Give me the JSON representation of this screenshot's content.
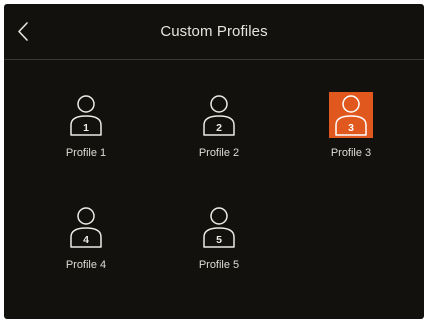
{
  "header": {
    "title": "Custom Profiles",
    "back_icon": "chevron-left-icon"
  },
  "accent_color": "#e1581e",
  "profiles": [
    {
      "number": "1",
      "label": "Profile 1",
      "selected": false,
      "icon": "user-icon"
    },
    {
      "number": "2",
      "label": "Profile 2",
      "selected": false,
      "icon": "user-icon"
    },
    {
      "number": "3",
      "label": "Profile 3",
      "selected": true,
      "icon": "user-icon"
    },
    {
      "number": "4",
      "label": "Profile 4",
      "selected": false,
      "icon": "user-icon"
    },
    {
      "number": "5",
      "label": "Profile 5",
      "selected": false,
      "icon": "user-icon"
    }
  ]
}
